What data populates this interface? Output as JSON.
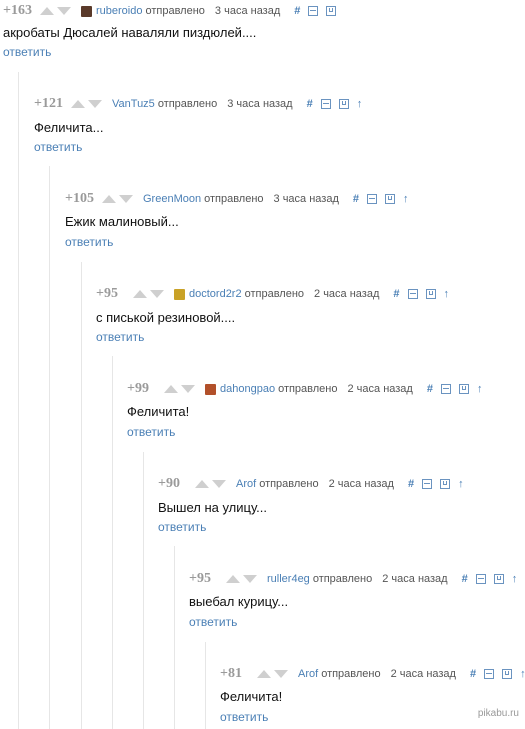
{
  "labels": {
    "sent": "отправлено",
    "reply": "ответить",
    "hash": "#",
    "arrow": "↑"
  },
  "comments": [
    {
      "score": "+163",
      "author": "ruberoido",
      "time": "3 часа назад",
      "text": "акробаты Дюсалей наваляли пиздюлей....",
      "avatar_color": "#5a3a2a"
    },
    {
      "score": "+121",
      "author": "VanTuz5",
      "time": "3 часа назад",
      "text": "Феличита..."
    },
    {
      "score": "+105",
      "author": "GreenMoon",
      "time": "3 часа назад",
      "text": "Ежик малиновый..."
    },
    {
      "score": "+95",
      "author": "doctord2r2",
      "time": "2 часа назад",
      "text": "с писькой резиновой....",
      "avatar_color": "#c9a227"
    },
    {
      "score": "+99",
      "author": "dahongpao",
      "time": "2 часа назад",
      "text": "Феличита!",
      "avatar_color": "#b2502a"
    },
    {
      "score": "+90",
      "author": "Arof",
      "time": "2 часа назад",
      "text": "Вышел на улицу..."
    },
    {
      "score": "+95",
      "author": "ruller4eg",
      "time": "2 часа назад",
      "text": "выебал курицу..."
    },
    {
      "score": "+81",
      "author": "Arof",
      "time": "2 часа назад",
      "text": "Феличита!"
    }
  ],
  "watermark": "pikabu.ru"
}
